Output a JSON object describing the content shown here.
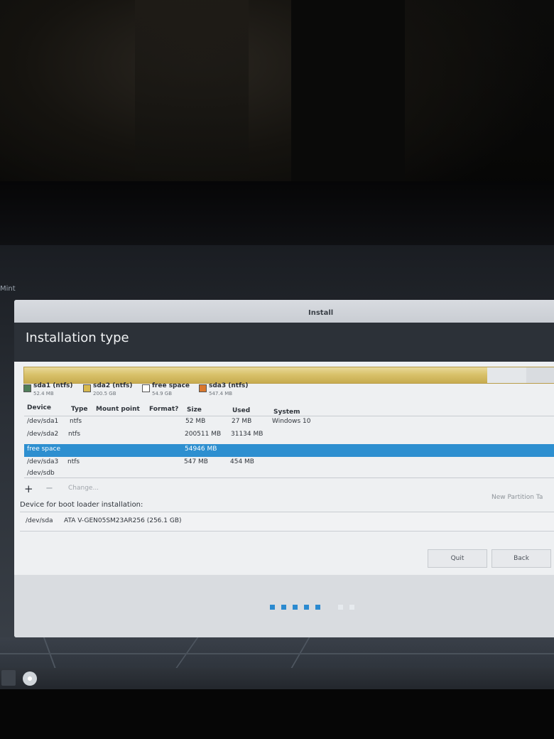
{
  "desktop": {
    "panel_label": "Mint"
  },
  "window": {
    "title": "Install"
  },
  "page": {
    "heading": "Installation type"
  },
  "partitions_legend": [
    {
      "name": "sda1 (ntfs)",
      "size": "52.4 MB",
      "color": "#4f7e59"
    },
    {
      "name": "sda2 (ntfs)",
      "size": "200.5 GB",
      "color": "#d7b94f"
    },
    {
      "name": "free space",
      "size": "54.9 GB",
      "color": "#ffffff"
    },
    {
      "name": "sda3 (ntfs)",
      "size": "547.4 MB",
      "color": "#d9782e"
    }
  ],
  "table": {
    "headers": {
      "device": "Device",
      "type": "Type",
      "mount": "Mount point",
      "format": "Format?",
      "size": "Size",
      "used": "Used",
      "system": "System"
    },
    "rows": [
      {
        "device": "/dev/sda1",
        "type": "ntfs",
        "size": "52 MB",
        "used": "27 MB",
        "system": "Windows 10"
      },
      {
        "device": "/dev/sda2",
        "type": "ntfs",
        "size": "200511 MB",
        "used": "31134 MB",
        "system": ""
      },
      {
        "device": "free space",
        "type": "",
        "size": "54946 MB",
        "used": "",
        "system": "",
        "selected": true
      },
      {
        "device": "/dev/sda3",
        "type": "ntfs",
        "size": "547 MB",
        "used": "454 MB",
        "system": ""
      },
      {
        "device": "/dev/sdb",
        "type": "",
        "size": "",
        "used": "",
        "system": ""
      }
    ]
  },
  "actions": {
    "add": "+",
    "remove": "−",
    "change": "Change...",
    "new_table": "New Partition Ta"
  },
  "boot_loader": {
    "label": "Device for boot loader installation:",
    "device": "/dev/sda",
    "model": "ATA V-GEN05SM23AR256 (256.1 GB)"
  },
  "buttons": {
    "quit": "Quit",
    "back": "Back"
  },
  "progress": {
    "completed_steps": 5,
    "total_steps": 7
  },
  "accent_color": "#2d8fd0"
}
